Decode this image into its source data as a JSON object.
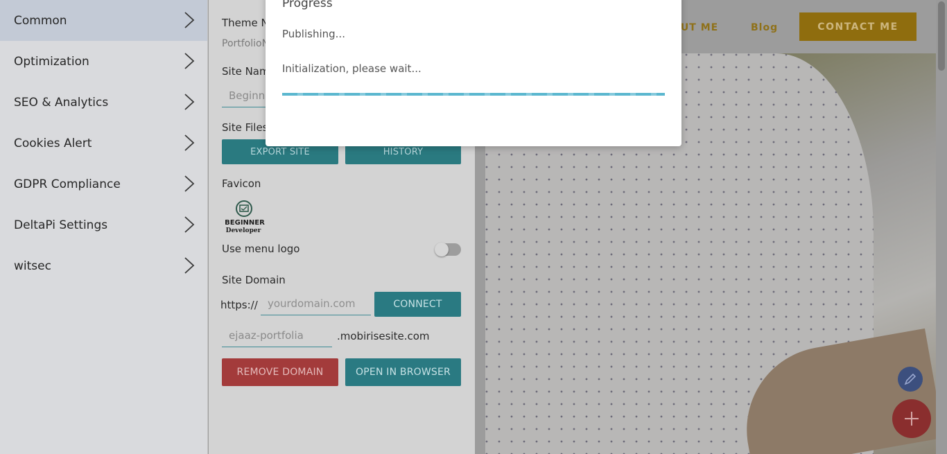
{
  "left_menu": {
    "items": [
      {
        "label": "Common"
      },
      {
        "label": "Optimization"
      },
      {
        "label": "SEO & Analytics"
      },
      {
        "label": "Cookies Alert"
      },
      {
        "label": "GDPR Compliance"
      },
      {
        "label": "DeltaPi Settings"
      },
      {
        "label": "witsec"
      }
    ]
  },
  "settings": {
    "theme_label": "Theme N",
    "theme_value": "PortfolioN",
    "site_name_label": "Site Nam",
    "site_name_value": "Beginne",
    "site_files_label": "Site Files",
    "export_button": "EXPORT SITE",
    "history_button": "HISTORY",
    "favicon_label": "Favicon",
    "logo_line1": "BEGINNER",
    "logo_line2": "Developer",
    "use_menu_logo_label": "Use menu logo",
    "use_menu_logo_on": false,
    "site_domain_label": "Site Domain",
    "protocol_prefix": "https://",
    "domain_placeholder": "yourdomain.com",
    "connect_button": "CONNECT",
    "subdomain_value": "ejaaz-portfolia",
    "subdomain_suffix": ".mobirisesite.com",
    "remove_domain_button": "REMOVE DOMAIN",
    "open_browser_button": "OPEN IN BROWSER"
  },
  "preview": {
    "nav_about": "OUT ME",
    "nav_blog": "Blog",
    "contact_button": "CONTACT ME"
  },
  "modal": {
    "title": "Progress",
    "status": "Publishing...",
    "detail": "Initialization, please wait..."
  },
  "colors": {
    "accent_teal": "#2a7a80",
    "danger_red": "#a33b3b",
    "progress_blue": "#5bb7cf"
  }
}
